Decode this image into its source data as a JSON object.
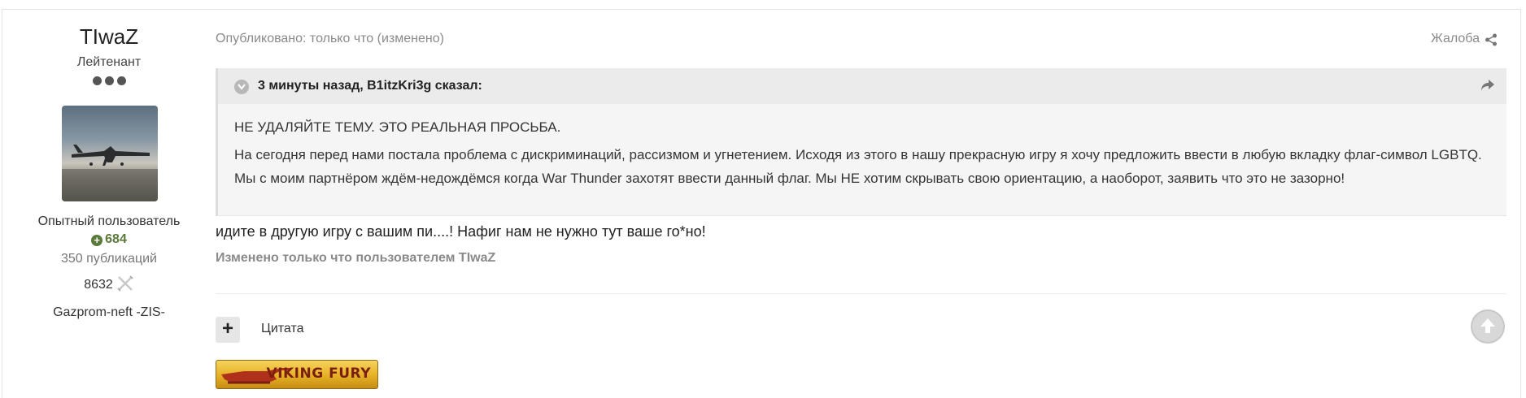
{
  "author": {
    "name": "TIwaZ",
    "rank": "Лейтенант",
    "group": "Опытный пользователь",
    "reputation": "684",
    "posts": "350 публикаций",
    "stat_value": "8632",
    "clan": "Gazprom-neft -ZIS-"
  },
  "post": {
    "published": "Опубликовано: только что (изменено)",
    "report_label": "Жалоба",
    "quote": {
      "citation": "3 минуты назад, B1itzKri3g сказал:",
      "line1": "НЕ УДАЛЯЙТЕ ТЕМУ. ЭТО РЕАЛЬНАЯ ПРОСЬБА.",
      "line2": "На сегодня перед нами постала проблема с дискриминаций, рассизмом и угнетением. Исходя из этого в нашу прекрасную игру я хочу предложить ввести в любую вкладку флаг-символ LGBTQ. Мы с моим партнёром ждём-недождёмся когда War Thunder захотят ввести данный флаг. Мы НЕ хотим скрывать свою ориентацию, а наоборот, заявить что это не зазорно!"
    },
    "reply": "идите в другую игру с вашим пи....! Нафиг нам  не нужно тут ваше го*но!",
    "edited": "Изменено только что пользователем TIwaZ",
    "quote_button_label": "Цитата",
    "banner_text": "VIKING FURY"
  },
  "colors": {
    "reputation": "#5b7a3a",
    "banner": "#e6b025"
  },
  "icons": [
    "share-icon",
    "chevron-down-icon",
    "go-to-quote-icon",
    "plus-icon",
    "arrow-up-icon",
    "crossed-swords-icon"
  ]
}
